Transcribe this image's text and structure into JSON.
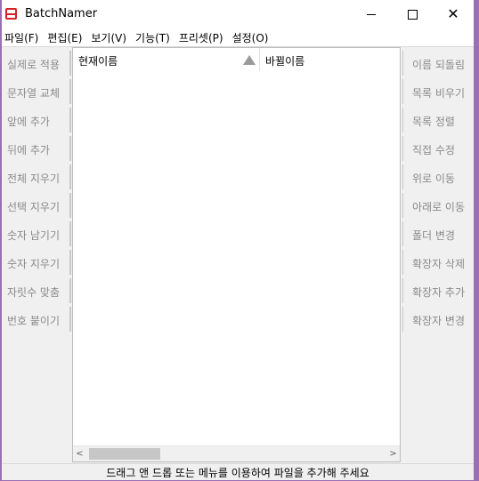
{
  "window": {
    "title": "BatchNamer",
    "close_symbol": "✕"
  },
  "menu": [
    "파일(F)",
    "편집(E)",
    "보기(V)",
    "기능(T)",
    "프리셋(P)",
    "설정(O)"
  ],
  "left_buttons": [
    "실제로 적용",
    "문자열 교체",
    "앞에 추가",
    "뒤에 추가",
    "전체 지우기",
    "선택 지우기",
    "숫자 남기기",
    "숫자 지우기",
    "자릿수 맞춤",
    "번호 붙이기"
  ],
  "right_buttons": [
    "이름 되돌림",
    "목록 비우기",
    "목록 정렬",
    "직접 수정",
    "위로 이동",
    "아래로 이동",
    "폴더 변경",
    "확장자 삭제",
    "확장자 추가",
    "확장자 변경"
  ],
  "list": {
    "col_current": "현재이름",
    "col_new": "바뀔이름",
    "scroll_left": "<",
    "scroll_right": ">"
  },
  "status": "드래그 앤 드롭 또는 메뉴를 이용하여 파일을 추가해 주세요"
}
